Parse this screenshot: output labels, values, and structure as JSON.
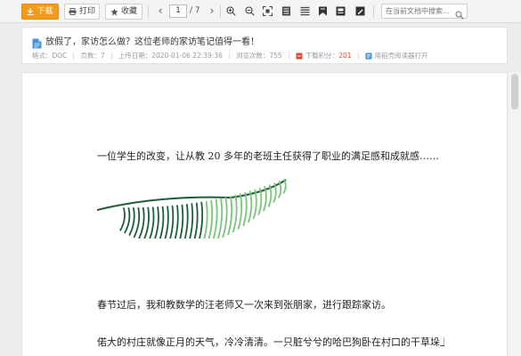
{
  "toolbar": {
    "download_label": "下载",
    "print_label": "打印",
    "favorite_label": "收藏",
    "current_page": "1",
    "total_pages": "/ 7",
    "search_placeholder": "在当前文档中搜索..."
  },
  "info": {
    "title": "放假了，家访怎么做？这位老师的家访笔记值得一看！",
    "format_label": "格式：",
    "format_value": "DOC",
    "pages_label": "页数：",
    "pages_value": "7",
    "upload_label": "上传日期：",
    "upload_value": "2020-01-06 22:39:36",
    "views_label": "浏览次数：",
    "views_value": "755",
    "points_label": "下载积分：",
    "points_value": "201",
    "open_reader_label": "用稻壳阅读器打开"
  },
  "document": {
    "paragraph_1": "一位学生的改变，让从教 20 多年的老班主任获得了职业的满足感和成就感……",
    "paragraph_2": "春节过后，我和教数学的汪老师又一次来到张朋家，进行跟踪家访。",
    "paragraph_3": "偌大的村庄就像正月的天气，冷冷清清。一只脏兮兮的哈巴狗卧在村口的干草垛上"
  },
  "colors": {
    "accent": "#f39a1e",
    "points_red": "#e04a2b",
    "leaf_dark": "#1f5d3a",
    "leaf_light": "#7cc47a"
  }
}
